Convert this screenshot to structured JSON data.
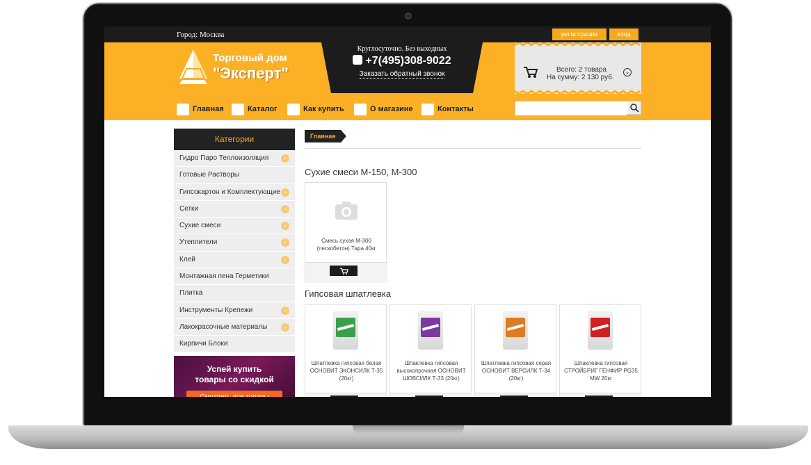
{
  "topbar": {
    "city": "Город: Москва",
    "register": "регистрация",
    "login": "вход"
  },
  "logo": {
    "line1": "Торговый дом",
    "line2": "\"Эксперт\""
  },
  "phone": {
    "hours": "Круглосуточно. Без выходных",
    "number": "+7(495)308-9022",
    "callback": "Заказать обратный звонок"
  },
  "cart": {
    "line1": "Всего: 2 товара",
    "line2": "На сумму: 2 130 руб."
  },
  "nav": [
    {
      "label": "Главная",
      "icon": "monitor-icon"
    },
    {
      "label": "Каталог",
      "icon": "catalog-icon"
    },
    {
      "label": "Как купить",
      "icon": "wallet-icon"
    },
    {
      "label": "О магазине",
      "icon": "truck-icon"
    },
    {
      "label": "Контакты",
      "icon": "phone-icon"
    }
  ],
  "search": {
    "placeholder": ""
  },
  "sidebar": {
    "header": "Категории",
    "items": [
      {
        "label": "Гидро Паро Теплоизоляция",
        "arrow": true
      },
      {
        "label": "Готовые Растворы",
        "arrow": false
      },
      {
        "label": "Гипсокартон и Комплектующие",
        "arrow": true
      },
      {
        "label": "Сетки",
        "arrow": true
      },
      {
        "label": "Сухие смеси",
        "arrow": true
      },
      {
        "label": "Утеплители",
        "arrow": true
      },
      {
        "label": "Клей",
        "arrow": true
      },
      {
        "label": "Монтажная пена Герметики",
        "arrow": false
      },
      {
        "label": "Плитка",
        "arrow": false
      },
      {
        "label": "Инструменты Крепежи",
        "arrow": true
      },
      {
        "label": "Лакокрасочные материалы",
        "arrow": true
      },
      {
        "label": "Кирпичи Блоки",
        "arrow": false
      }
    ],
    "promo": {
      "title_line1": "Успей купить",
      "title_line2": "товары со скидкой",
      "button": "Смотреть все товары"
    }
  },
  "main": {
    "breadcrumb": "Главная",
    "sections": [
      {
        "title": "Сухие смеси М-150, М-300"
      },
      {
        "title": "Гипсовая шпатлевка"
      }
    ],
    "dry_products": [
      {
        "name_line1": "Смесь сухая М-300",
        "name_line2": "(пескобетон) Тара 40кг"
      }
    ],
    "gypsum_products": [
      {
        "name_line1": "Шпатлевка гипсовая белая",
        "name_line2": "ОСНОВИТ ЭКОНСИЛК Т-35",
        "name_line3": "(20кг)",
        "color": "#3aa14a"
      },
      {
        "name_line1": "Шпаклевка гипсовая",
        "name_line2": "высокопрочная ОСНОВИТ",
        "name_line3": "ШОВСИЛК Т-33 (20кг)",
        "color": "#7a3aa0"
      },
      {
        "name_line1": "Шпатлевка гипсовая серая",
        "name_line2": "ОСНОВИТ ВЕРСИЛК Т-34",
        "name_line3": "(20кг)",
        "color": "#e07a20"
      },
      {
        "name_line1": "Шпаклевка гипсовая",
        "name_line2": "СТРОЙБРИГ ГЕНФИР PG35",
        "name_line3": "MW 20кг",
        "color": "#d02020"
      }
    ]
  },
  "colors": {
    "accent": "#fbb026",
    "dark": "#1c1c1c",
    "breadcrumb_text": "#f6a91f"
  }
}
